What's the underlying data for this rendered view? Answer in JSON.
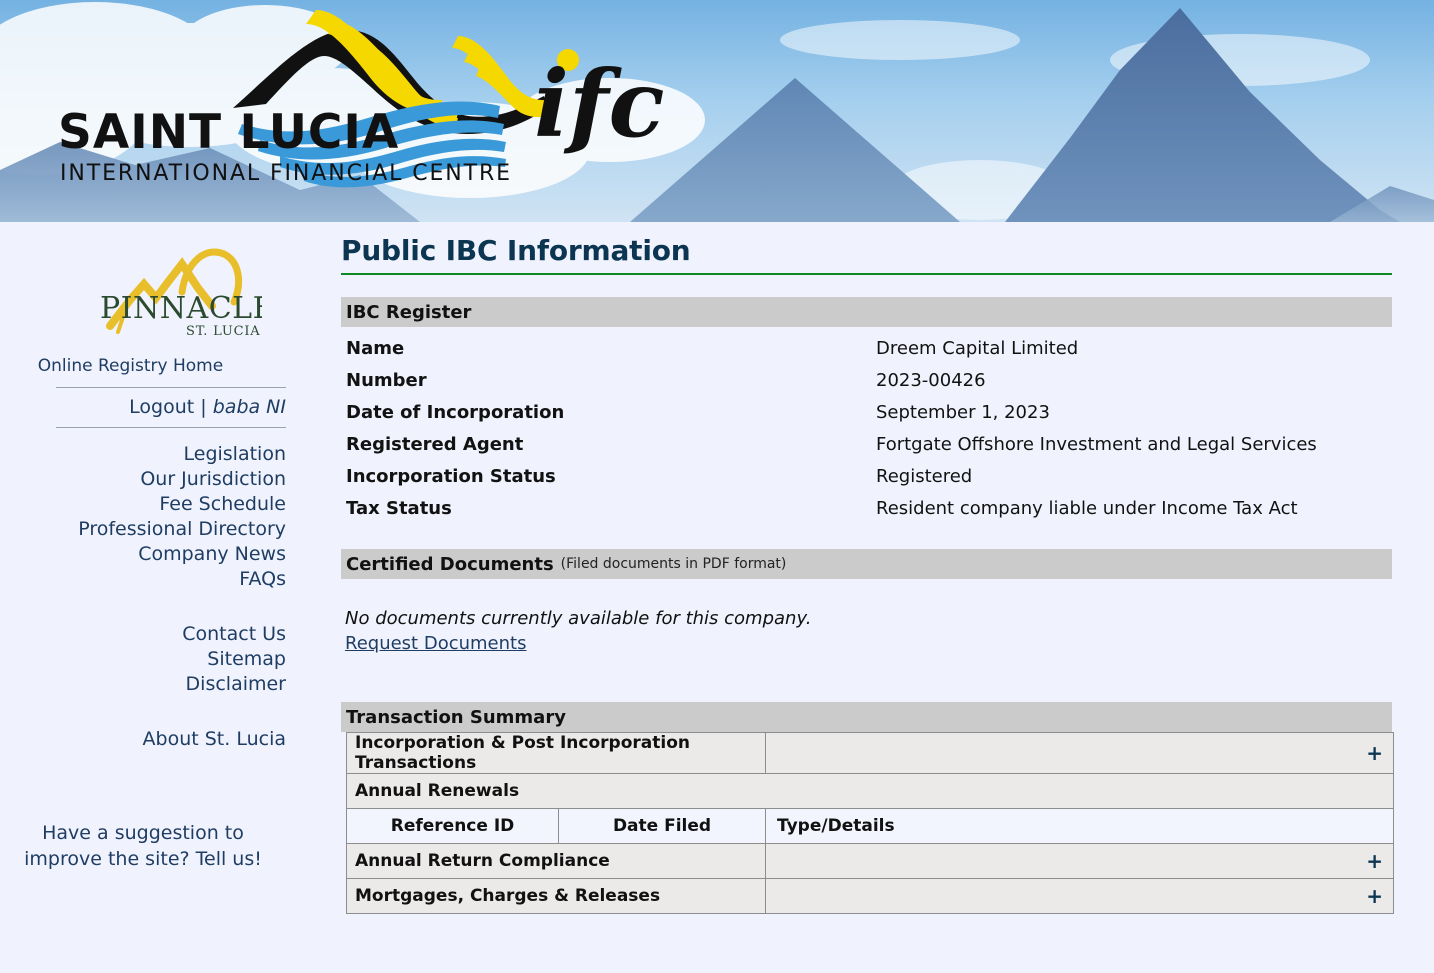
{
  "banner": {
    "logo_title": "SAINT LUCIA",
    "logo_subtitle": "INTERNATIONAL FINANCIAL CENTRE",
    "logo_mark": "ifc",
    "colors": {
      "yellow": "#f5d800",
      "black": "#111111",
      "blue": "#3a9ad9",
      "sky": "#9ecbec"
    }
  },
  "sidebar": {
    "logo_word": "PINNACLE",
    "logo_sub": "ST. LUCIA",
    "home_label": "Online Registry Home",
    "logout_label": "Logout",
    "separator": "|",
    "username": "baba NI",
    "links_primary": [
      "Legislation",
      "Our Jurisdiction",
      "Fee Schedule",
      "Professional Directory",
      "Company News",
      "FAQs"
    ],
    "links_secondary": [
      "Contact Us",
      "Sitemap",
      "Disclaimer"
    ],
    "links_tertiary": [
      "About St. Lucia"
    ],
    "suggestion_line1": "Have a suggestion to",
    "suggestion_line2": "improve the site? Tell us!"
  },
  "main": {
    "page_title": "Public IBC Information",
    "register": {
      "heading": "IBC Register",
      "rows": [
        {
          "label": "Name",
          "value": "Dreem Capital Limited"
        },
        {
          "label": "Number",
          "value": "2023-00426"
        },
        {
          "label": "Date of Incorporation",
          "value": "September 1, 2023"
        },
        {
          "label": "Registered Agent",
          "value": "Fortgate Offshore Investment and Legal Services"
        },
        {
          "label": "Incorporation Status",
          "value": "Registered"
        },
        {
          "label": "Tax Status",
          "value": "Resident company liable under Income Tax Act"
        }
      ]
    },
    "documents": {
      "heading": "Certified Documents",
      "heading_note": "(Filed documents in PDF format)",
      "empty_message": "No documents currently available for this company.",
      "request_link": "Request Documents"
    },
    "transactions": {
      "heading": "Transaction Summary",
      "sections": [
        {
          "label": "Incorporation & Post Incorporation Transactions",
          "toggle": "+"
        },
        {
          "label": "Annual Renewals",
          "toggle": ""
        },
        {
          "label": "Annual Return Compliance",
          "toggle": "+"
        },
        {
          "label": "Mortgages, Charges & Releases",
          "toggle": "+"
        }
      ],
      "renewals_columns": [
        "Reference ID",
        "Date Filed",
        "Type/Details"
      ],
      "renewals_rows": []
    }
  }
}
